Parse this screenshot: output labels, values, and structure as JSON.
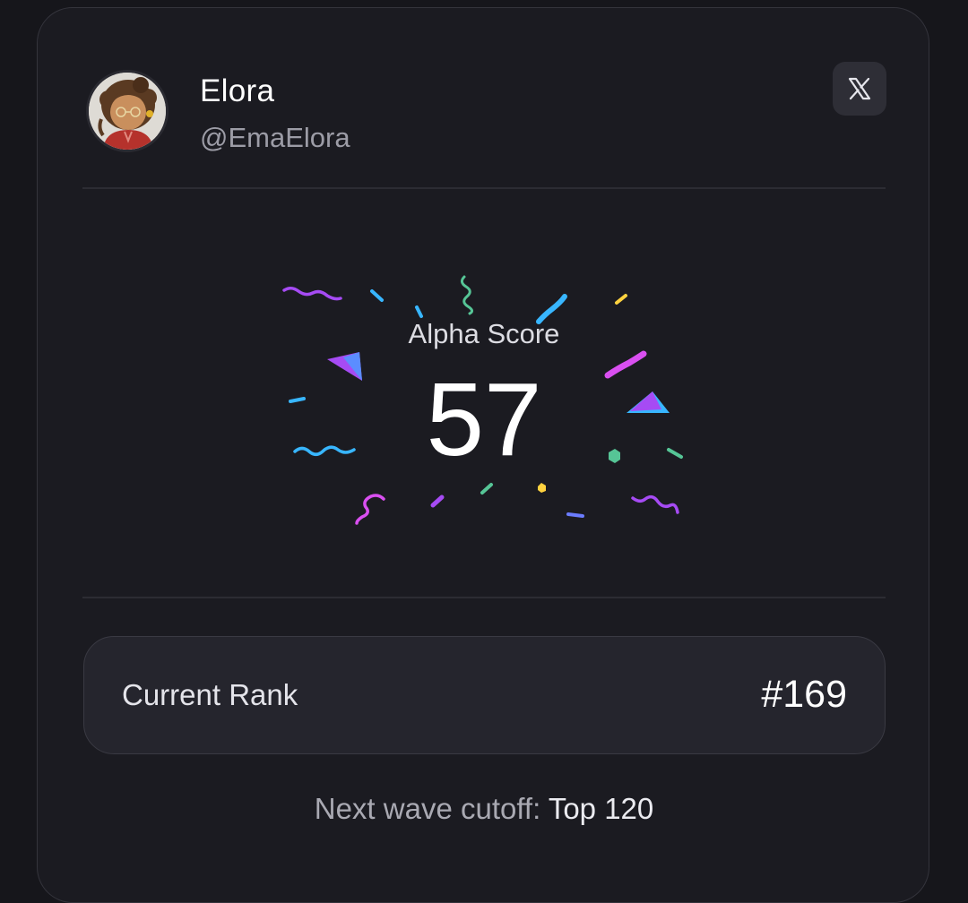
{
  "profile": {
    "name": "Elora",
    "handle": "@EmaElora"
  },
  "score": {
    "label": "Alpha Score",
    "value": "57"
  },
  "rank": {
    "label": "Current Rank",
    "value": "#169"
  },
  "cutoff": {
    "label": "Next wave cutoff:",
    "value": "Top 120"
  },
  "icons": {
    "close": "x-logo-icon",
    "confetti": "confetti-decoration"
  },
  "colors": {
    "background": "#16161b",
    "card": "#1b1b21",
    "rank_box": "#25252d",
    "confetti_purple": "#a64bf4",
    "confetti_blue": "#38b6ff",
    "confetti_green": "#56c596",
    "confetti_yellow": "#ffd23f",
    "confetti_magenta": "#d94ff0"
  }
}
